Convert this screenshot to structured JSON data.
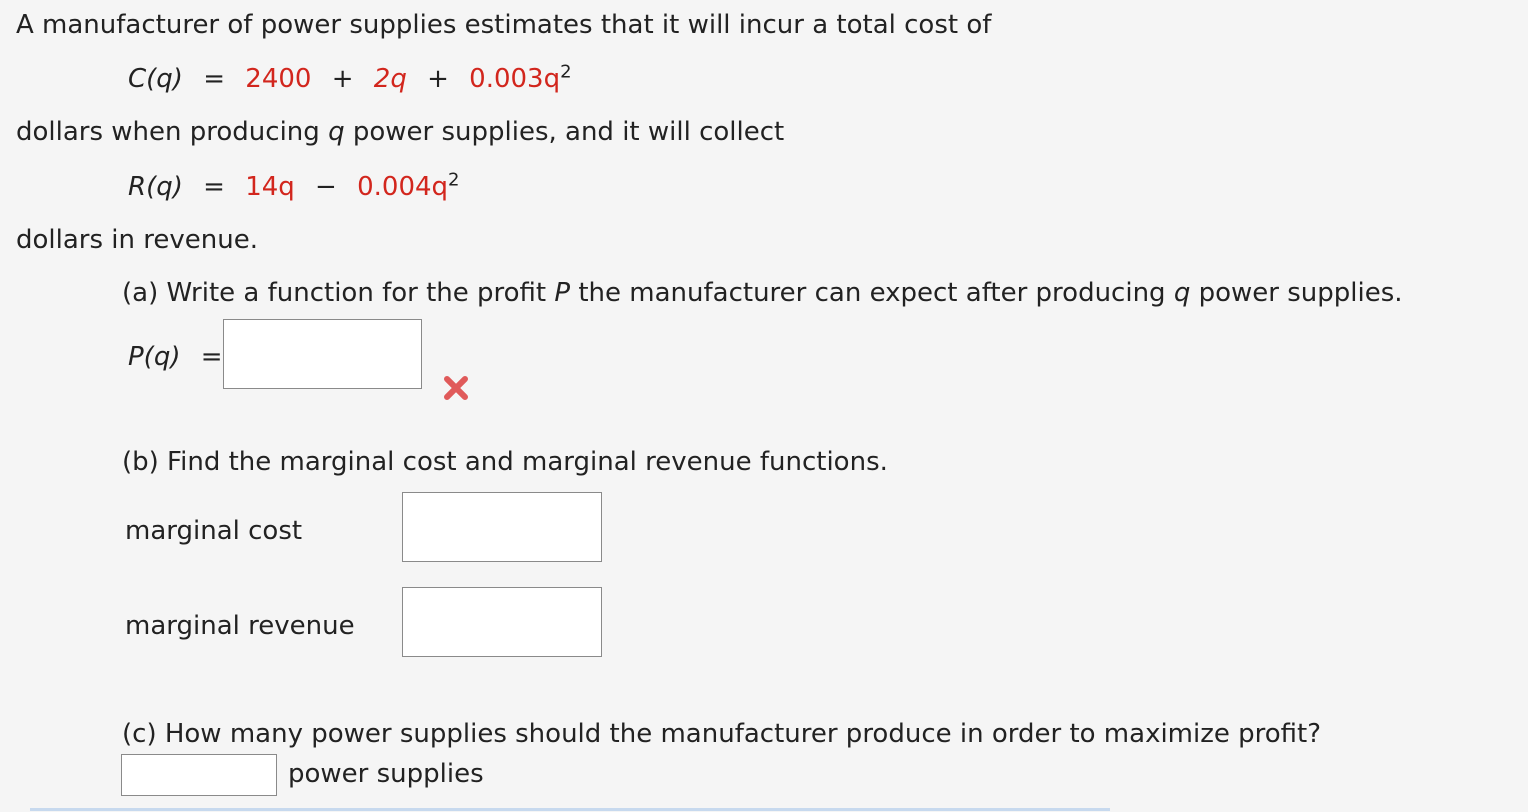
{
  "intro": {
    "line1": "A manufacturer of power supplies estimates that it will incur a total cost of",
    "line2_a": "dollars when producing",
    "line2_var": "q",
    "line2_b": "power supplies, and it will collect",
    "line3": "dollars in revenue."
  },
  "cost_eq": {
    "lhs": "C(q)",
    "eq": "=",
    "t1": "2400",
    "op1": "+",
    "t2": "2q",
    "op2": "+",
    "t3": "0.003q",
    "exp": "2"
  },
  "rev_eq": {
    "lhs": "R(q)",
    "eq": "=",
    "t1": "14q",
    "op1": "−",
    "t2": "0.004q",
    "exp": "2"
  },
  "part_a": {
    "prompt_a": "(a) Write a function for the profit",
    "var_p": "P",
    "prompt_b": "the manufacturer can expect after producing",
    "var_q": "q",
    "prompt_c": "power supplies.",
    "label": "P(q)",
    "eq": "=",
    "value": "",
    "status_icon": "incorrect-x-icon",
    "status_color": "#e05a5a"
  },
  "part_b": {
    "prompt": "(b) Find the marginal cost and marginal revenue functions.",
    "mc_label": "marginal cost",
    "mc_value": "",
    "mr_label": "marginal revenue",
    "mr_value": ""
  },
  "part_c": {
    "prompt": "(c) How many power supplies should the manufacturer produce in order to maximize profit?",
    "value": "",
    "unit": "power supplies"
  }
}
